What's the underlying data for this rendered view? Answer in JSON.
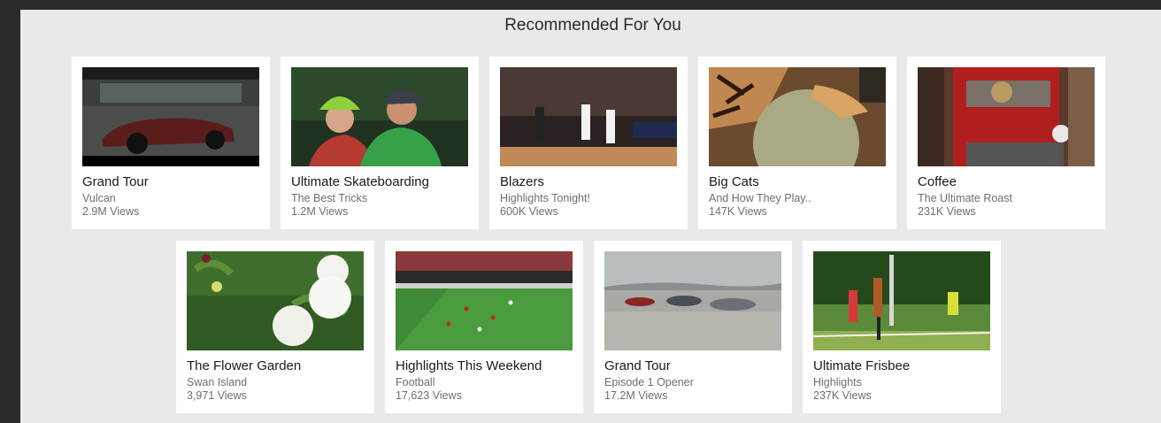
{
  "section": {
    "heading": "Recommended For You"
  },
  "videos": [
    {
      "title": "Grand Tour",
      "subtitle": "Vulcan",
      "views": "2.9M Views",
      "thumbnail": "car-thumbnail"
    },
    {
      "title": "Ultimate Skateboarding",
      "subtitle": "The Best Tricks",
      "views": "1.2M Views",
      "thumbnail": "skateboarders-thumbnail"
    },
    {
      "title": "Blazers",
      "subtitle": "Highlights Tonight!",
      "views": "600K Views",
      "thumbnail": "basketball-thumbnail"
    },
    {
      "title": "Big Cats",
      "subtitle": "And How They Play..",
      "views": "147K Views",
      "thumbnail": "tiger-ball-thumbnail"
    },
    {
      "title": "Coffee",
      "subtitle": "The Ultimate Roast",
      "views": "231K Views",
      "thumbnail": "coffee-roaster-thumbnail"
    },
    {
      "title": "The Flower Garden",
      "subtitle": "Swan Island",
      "views": "3,971 Views",
      "thumbnail": "dahlia-flowers-thumbnail"
    },
    {
      "title": "Highlights This Weekend",
      "subtitle": "Football",
      "views": "17,623 Views",
      "thumbnail": "soccer-field-thumbnail"
    },
    {
      "title": "Grand Tour",
      "subtitle": "Episode 1 Opener",
      "views": "17.2M Views",
      "thumbnail": "cars-drifting-thumbnail"
    },
    {
      "title": "Ultimate Frisbee",
      "subtitle": "Highlights",
      "views": "237K Views",
      "thumbnail": "frisbee-players-thumbnail"
    }
  ]
}
